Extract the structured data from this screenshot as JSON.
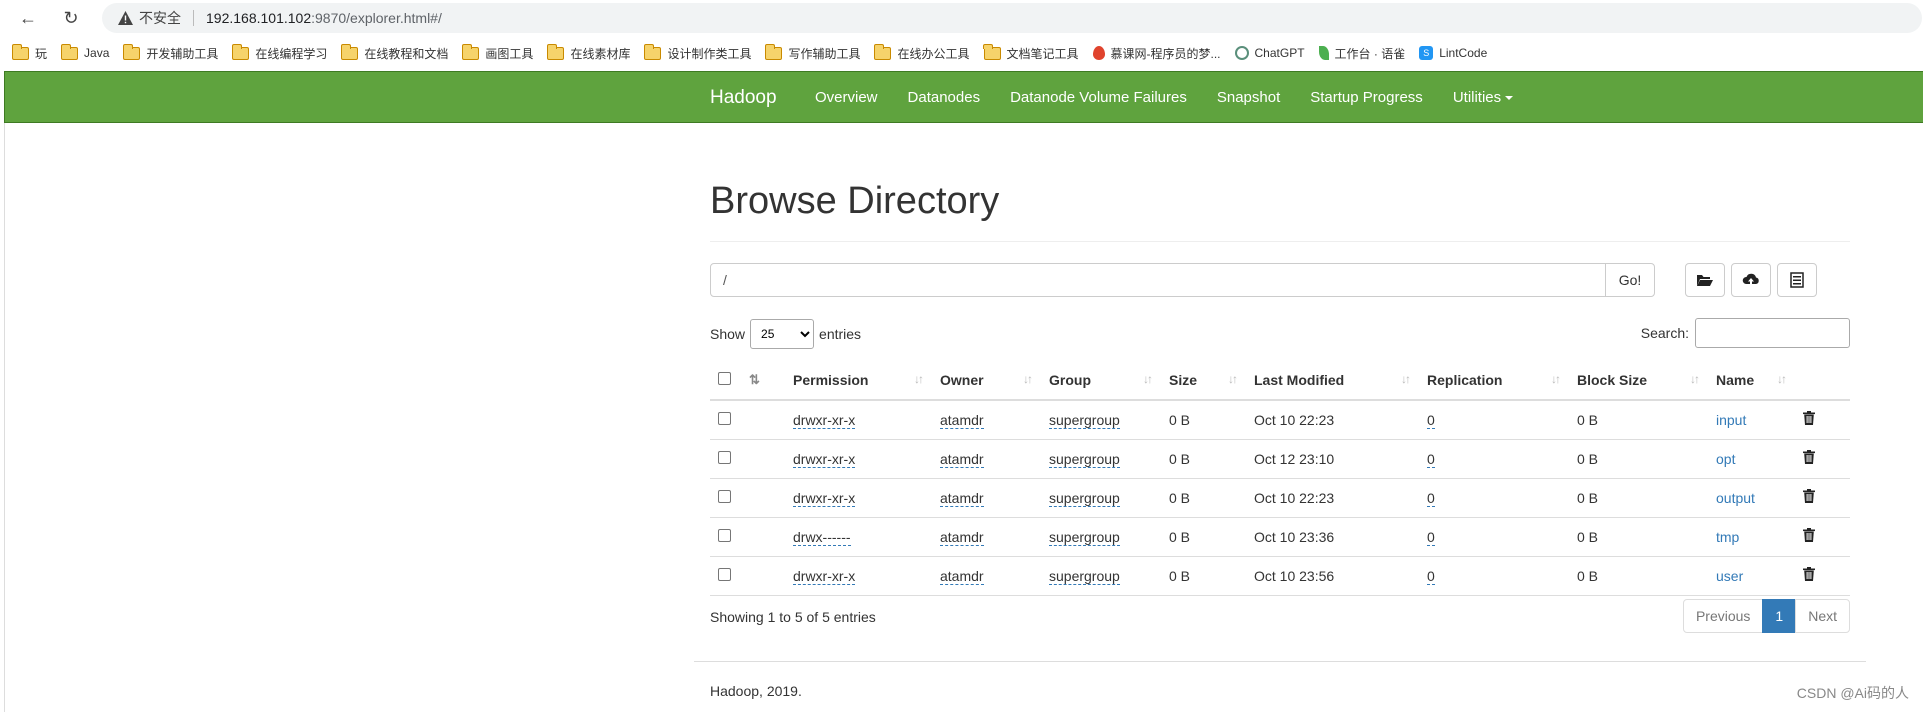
{
  "browser": {
    "security_label": "不安全",
    "url_host": "192.168.101.102",
    "url_path": ":9870/explorer.html#/"
  },
  "bookmarks": [
    {
      "label": "玩",
      "icon": "folder-icon"
    },
    {
      "label": "Java",
      "icon": "folder-icon"
    },
    {
      "label": "开发辅助工具",
      "icon": "folder-icon"
    },
    {
      "label": "在线编程学习",
      "icon": "folder-icon"
    },
    {
      "label": "在线教程和文档",
      "icon": "folder-icon"
    },
    {
      "label": "画图工具",
      "icon": "folder-icon"
    },
    {
      "label": "在线素材库",
      "icon": "folder-icon"
    },
    {
      "label": "设计制作类工具",
      "icon": "folder-icon"
    },
    {
      "label": "写作辅助工具",
      "icon": "folder-icon"
    },
    {
      "label": "在线办公工具",
      "icon": "folder-icon"
    },
    {
      "label": "文档笔记工具",
      "icon": "folder-icon"
    },
    {
      "label": "慕课网-程序员的梦...",
      "icon": "fire-icon"
    },
    {
      "label": "ChatGPT",
      "icon": "chatgpt-icon"
    },
    {
      "label": "工作台 · 语雀",
      "icon": "leaf-icon"
    },
    {
      "label": "LintCode",
      "icon": "lintcode-icon"
    }
  ],
  "navbar": {
    "brand": "Hadoop",
    "items": [
      "Overview",
      "Datanodes",
      "Datanode Volume Failures",
      "Snapshot",
      "Startup Progress",
      "Utilities"
    ],
    "bg_color": "#5fa33e"
  },
  "page": {
    "title": "Browse Directory",
    "path_value": "/",
    "go_label": "Go!",
    "show_label": "Show",
    "entries_label": "entries",
    "page_size": "25",
    "search_label": "Search:",
    "info": "Showing 1 to 5 of 5 entries",
    "pager": {
      "previous": "Previous",
      "current": "1",
      "next": "Next"
    },
    "footer": "Hadoop, 2019."
  },
  "table": {
    "headers": [
      "Permission",
      "Owner",
      "Group",
      "Size",
      "Last Modified",
      "Replication",
      "Block Size",
      "Name"
    ],
    "rows": [
      {
        "permission": "drwxr-xr-x",
        "owner": "atamdr",
        "group": "supergroup",
        "size": "0 B",
        "modified": "Oct 10 22:23",
        "replication": "0",
        "block_size": "0 B",
        "name": "input"
      },
      {
        "permission": "drwxr-xr-x",
        "owner": "atamdr",
        "group": "supergroup",
        "size": "0 B",
        "modified": "Oct 12 23:10",
        "replication": "0",
        "block_size": "0 B",
        "name": "opt"
      },
      {
        "permission": "drwxr-xr-x",
        "owner": "atamdr",
        "group": "supergroup",
        "size": "0 B",
        "modified": "Oct 10 22:23",
        "replication": "0",
        "block_size": "0 B",
        "name": "output"
      },
      {
        "permission": "drwx------",
        "owner": "atamdr",
        "group": "supergroup",
        "size": "0 B",
        "modified": "Oct 10 23:36",
        "replication": "0",
        "block_size": "0 B",
        "name": "tmp"
      },
      {
        "permission": "drwxr-xr-x",
        "owner": "atamdr",
        "group": "supergroup",
        "size": "0 B",
        "modified": "Oct 10 23:56",
        "replication": "0",
        "block_size": "0 B",
        "name": "user"
      }
    ]
  },
  "watermark": "CSDN @Ai码的人"
}
